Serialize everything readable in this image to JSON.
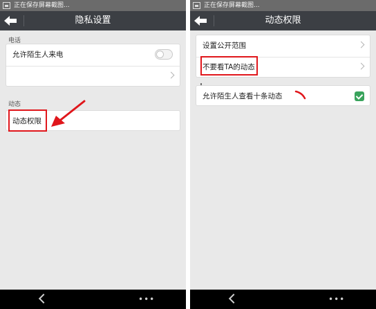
{
  "status_bar": {
    "text": "正在保存屏幕截图..."
  },
  "left_screen": {
    "title": "隐私设置",
    "sections": [
      {
        "label": "电话",
        "items": [
          {
            "label": "允许陌生人来电"
          },
          {
            "label": ""
          }
        ]
      },
      {
        "label": "动态",
        "items": [
          {
            "label": "动态权限"
          }
        ]
      }
    ]
  },
  "right_screen": {
    "title": "动态权限",
    "items": [
      {
        "label": "设置公开范围"
      },
      {
        "label": "不要看TA的动态"
      },
      {
        "label": "允许陌生人查看十条动态"
      }
    ]
  },
  "icons": {
    "back": "back-arrow-icon",
    "nav_back": "nav-back-icon",
    "nav_more": "more-dots-icon",
    "chevron": "chevron-right-icon",
    "toggle": "toggle-switch-icon",
    "check": "checkmark-icon",
    "status": "image-icon"
  },
  "colors": {
    "title_bar": "#3c3f44",
    "status_bar": "#6b6b6b",
    "background": "#e9e9e9",
    "highlight": "#e0161b",
    "check_green": "#39a35c"
  }
}
